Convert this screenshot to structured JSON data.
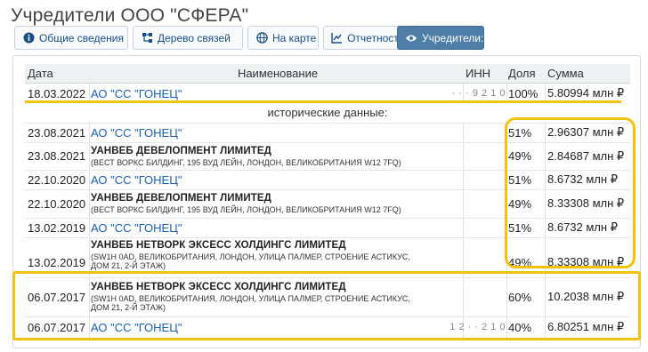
{
  "title": "Учредители ООО \"СФЕРА\"",
  "tabs": [
    {
      "label": "Общие сведения",
      "icon": "info-icon"
    },
    {
      "label": "Дерево связей",
      "icon": "tree-icon"
    },
    {
      "label": "На карте",
      "icon": "globe-icon"
    },
    {
      "label": "Отчетность",
      "icon": "chart-icon"
    },
    {
      "label": "Учредители:",
      "icon": "eye-icon",
      "active": true
    }
  ],
  "table": {
    "headers": {
      "date": "Дата",
      "name": "Наименование",
      "inn": "ИНН",
      "share": "Доля",
      "sum": "Сумма"
    },
    "current": {
      "date": "18.03.2022",
      "name": "АО \"СС \"ГОНЕЦ\"",
      "inn": "· · · · ·  · · 9 2 1 0",
      "share": "100%",
      "sum": "5.80994 млн ₽"
    },
    "historical_label": "исторические данные:",
    "rows": [
      {
        "date": "23.08.2021",
        "name": "АО \"СС \"ГОНЕЦ\"",
        "share": "51%",
        "sum": "2.96307 млн ₽"
      },
      {
        "date": "23.08.2021",
        "name": "УАНВЕБ ДЕВЕЛОПМЕНТ ЛИМИТЕД",
        "address": "(ВЕСТ ВОРКС БИЛДИНГ, 195 ВУД ЛЕЙН, ЛОНДОН, ВЕЛИКОБРИТАНИЯ W12 7FQ)",
        "share": "49%",
        "sum": "2.84687 млн ₽"
      },
      {
        "date": "22.10.2020",
        "name": "АО \"СС \"ГОНЕЦ\"",
        "share": "51%",
        "sum": "8.6732 млн ₽"
      },
      {
        "date": "22.10.2020",
        "name": "УАНВЕБ ДЕВЕЛОПМЕНТ ЛИМИТЕД",
        "address": "(ВЕСТ ВОРКС БИЛДИНГ, 195 ВУД ЛЕЙН, ЛОНДОН, ВЕЛИКОБРИТАНИЯ W12 7FQ)",
        "share": "49%",
        "sum": "8.33308 млн ₽"
      },
      {
        "date": "13.02.2019",
        "name": "АО \"СС \"ГОНЕЦ\"",
        "share": "51%",
        "sum": "8.6732 млн ₽"
      },
      {
        "date": "13.02.2019",
        "name": "УАНВЕБ НЕТВОРК ЭКСЕСС ХОЛДИНГС ЛИМИТЕД",
        "address": "(SW1H 0AD, ВЕЛИКОБРИТАНИЯ, ЛОНДОН, УЛИЦА ПАЛМЕР, СТРОЕНИЕ АСТИКУС,",
        "address2": "ДОМ 21, 2-Й ЭТАЖ)",
        "share": "49%",
        "sum": "8.33308 млн ₽"
      },
      {
        "date": "06.07.2017",
        "name": "УАНВЕБ НЕТВОРК ЭКСЕСС ХОЛДИНГС ЛИМИТЕД",
        "address": "(SW1H 0AD, ВЕЛИКОБРИТАНИЯ, ЛОНДОН, УЛИЦА ПАЛМЕР, СТРОЕНИЕ АСТИКУС,",
        "address2": "ДОМ 21, 2-Й ЭТАЖ)",
        "share": "60%",
        "sum": "10.2038 млн ₽"
      },
      {
        "date": "06.07.2017",
        "name": "АО \"СС \"ГОНЕЦ\"",
        "inn": "· 7 · 1 2 · · 2 1 0",
        "share": "40%",
        "sum": "6.80251 млн ₽"
      }
    ]
  },
  "colors": {
    "highlight": "#f4c20d",
    "link": "#1a5fb4",
    "active_tab": "#4e7ea8"
  }
}
